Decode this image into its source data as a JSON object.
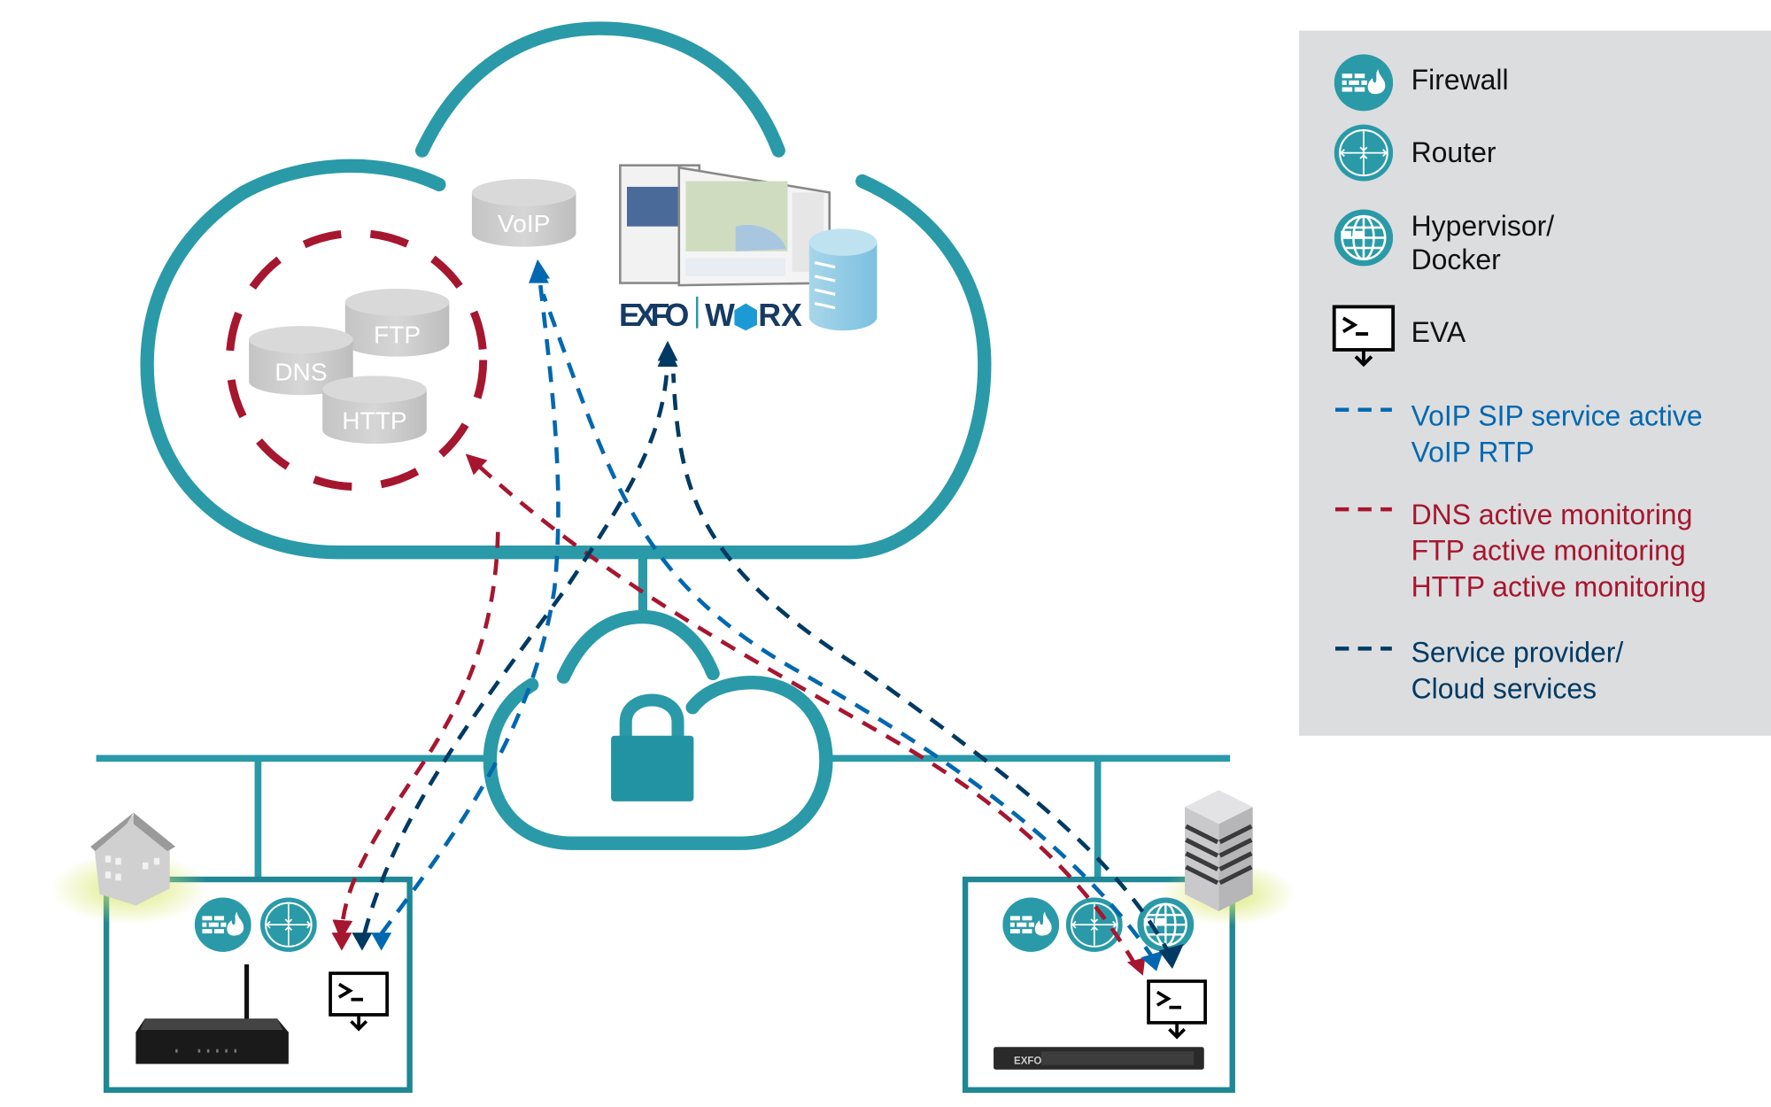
{
  "colors": {
    "teal": "#2a9aa8",
    "teal_light": "#3fbacd",
    "voip": "#0068b0",
    "monitoring": "#a6162f",
    "service": "#003a63",
    "legend_bg": "#dcdddf"
  },
  "cloud": {
    "services": {
      "voip": "VoIP",
      "ftp": "FTP",
      "dns": "DNS",
      "http": "HTTP"
    },
    "logo": {
      "left": "EXFO",
      "right_w": "W",
      "right_rx": "RX"
    }
  },
  "sites": {
    "right_rack_label": "EXFO"
  },
  "legend": {
    "icons": [
      {
        "icon": "firewall-icon",
        "label": "Firewall"
      },
      {
        "icon": "router-icon",
        "label": "Router"
      },
      {
        "icon": "hypervisor-icon",
        "label_lines": [
          "Hypervisor/",
          "Docker"
        ]
      },
      {
        "icon": "eva-icon",
        "label": "EVA"
      }
    ],
    "lines": [
      {
        "color": "#0068b0",
        "label_lines": [
          "VoIP SIP service active",
          "VoIP RTP"
        ]
      },
      {
        "color": "#a6162f",
        "label_lines": [
          "DNS active monitoring",
          "FTP active monitoring",
          "HTTP active monitoring"
        ]
      },
      {
        "color": "#003a63",
        "label_lines": [
          "Service provider/",
          "Cloud services"
        ]
      }
    ]
  }
}
